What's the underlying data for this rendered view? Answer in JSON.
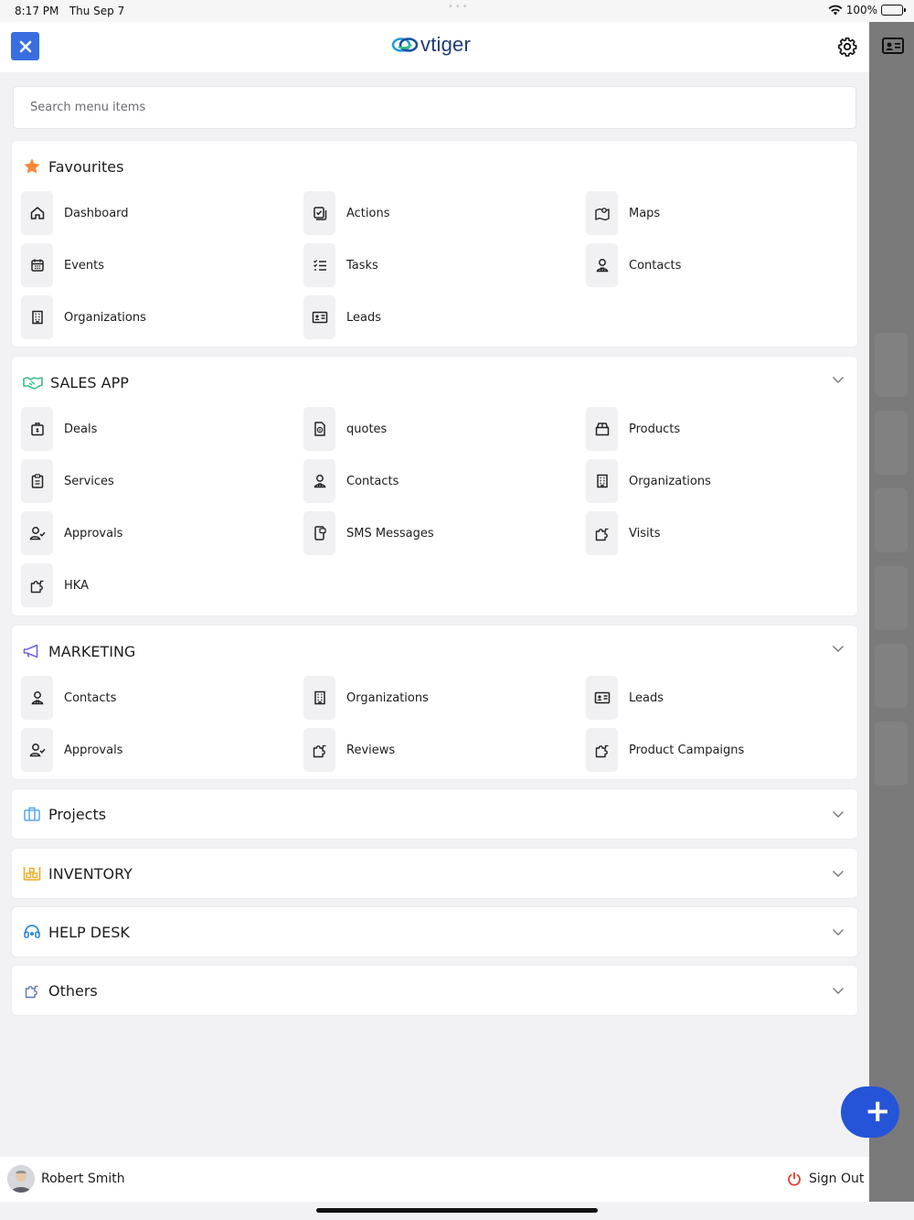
{
  "status_bar": {
    "time": "8:17 PM",
    "date": "Thu Sep 7",
    "battery": "100%"
  },
  "header": {
    "logo_text": "vtiger",
    "close_icon": "close-icon",
    "settings_icon": "gear-icon"
  },
  "search": {
    "placeholder": "Search menu items",
    "value": ""
  },
  "favourites": {
    "title": "Favourites",
    "icon": "star-icon",
    "items": [
      {
        "label": "Dashboard",
        "icon": "home-icon"
      },
      {
        "label": "Actions",
        "icon": "actions-icon"
      },
      {
        "label": "Maps",
        "icon": "map-icon"
      },
      {
        "label": "Events",
        "icon": "calendar-icon"
      },
      {
        "label": "Tasks",
        "icon": "task-list-icon"
      },
      {
        "label": "Contacts",
        "icon": "contact-icon"
      },
      {
        "label": "Organizations",
        "icon": "building-icon"
      },
      {
        "label": "Leads",
        "icon": "id-card-icon"
      }
    ]
  },
  "sales_app": {
    "title": "SALES APP",
    "icon": "handshake-icon",
    "items": [
      {
        "label": "Deals",
        "icon": "deal-bag-icon"
      },
      {
        "label": "quotes",
        "icon": "quote-doc-icon"
      },
      {
        "label": "Products",
        "icon": "product-box-icon"
      },
      {
        "label": "Services",
        "icon": "clipboard-icon"
      },
      {
        "label": "Contacts",
        "icon": "contact-icon"
      },
      {
        "label": "Organizations",
        "icon": "building-icon"
      },
      {
        "label": "Approvals",
        "icon": "user-check-icon"
      },
      {
        "label": "SMS Messages",
        "icon": "sms-icon"
      },
      {
        "label": "Visits",
        "icon": "puzzle-icon"
      },
      {
        "label": "HKA",
        "icon": "puzzle-icon"
      }
    ]
  },
  "marketing": {
    "title": "MARKETING",
    "icon": "megaphone-icon",
    "items": [
      {
        "label": "Contacts",
        "icon": "contact-icon"
      },
      {
        "label": "Organizations",
        "icon": "building-icon"
      },
      {
        "label": "Leads",
        "icon": "id-card-icon"
      },
      {
        "label": "Approvals",
        "icon": "user-check-icon"
      },
      {
        "label": "Reviews",
        "icon": "puzzle-icon"
      },
      {
        "label": "Product Campaigns",
        "icon": "puzzle-icon"
      }
    ]
  },
  "collapsed_sections": [
    {
      "title": "Projects",
      "icon": "projects-icon"
    },
    {
      "title": "INVENTORY",
      "icon": "inventory-icon"
    },
    {
      "title": "HELP DESK",
      "icon": "headset-icon"
    },
    {
      "title": "Others",
      "icon": "puzzle-icon"
    }
  ],
  "footer": {
    "user_name": "Robert Smith",
    "signout_label": "Sign Out"
  },
  "colors": {
    "accent_blue": "#3a6de0",
    "fab_blue": "#2554d8",
    "star_orange": "#f5883a",
    "sales_green": "#39c08a",
    "marketing_purple": "#6f67e0",
    "projects_blue": "#5aa7e6",
    "inventory_orange": "#f2a81d",
    "helpdesk_blue": "#2f8ad9",
    "signout_red": "#e5392f"
  }
}
